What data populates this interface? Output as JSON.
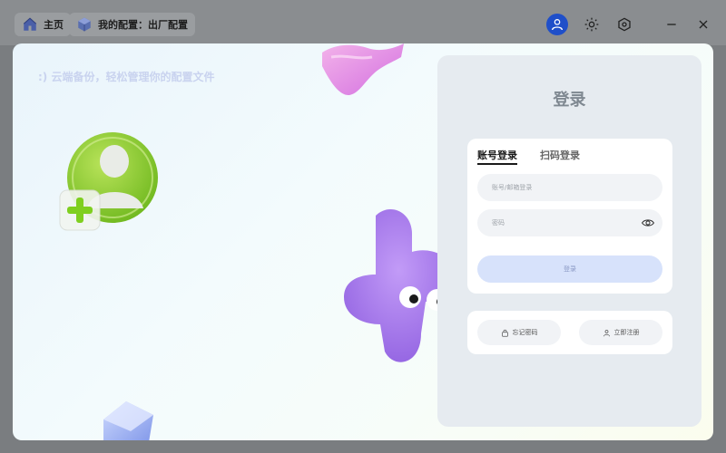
{
  "topbar": {
    "home_label": "主页",
    "config_label": "我的配置：出厂配置",
    "icons": [
      "house-icon",
      "cube-icon",
      "user-icon",
      "sun-icon",
      "settings-icon",
      "minimize-icon",
      "close-icon"
    ]
  },
  "main": {
    "slogan": ":)  云端备份，轻松管理你的配置文件"
  },
  "login": {
    "title": "登录",
    "tabs": [
      {
        "label": "账号登录",
        "active": true
      },
      {
        "label": "扫码登录",
        "active": false
      }
    ],
    "account_placeholder": "账号/邮箱登录",
    "password_placeholder": "密码",
    "submit_label": "登录",
    "forgot_label": "忘记密码",
    "register_label": "立即注册"
  },
  "colors": {
    "accent": "#1f4fc9",
    "panel": "#e6ebf0",
    "button": "#d7e2fb"
  }
}
